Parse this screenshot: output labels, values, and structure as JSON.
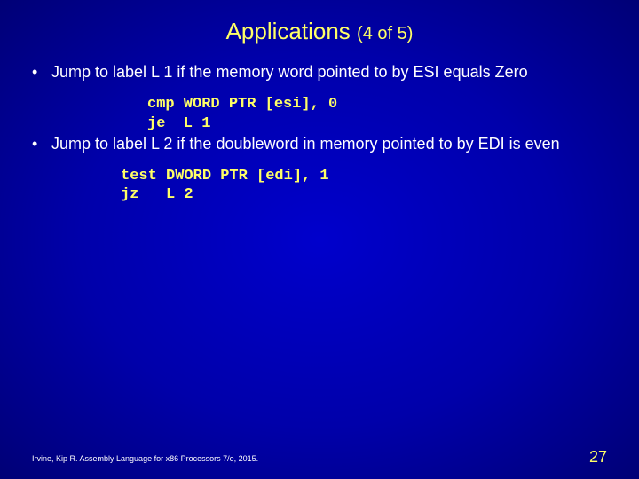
{
  "title": {
    "main": "Applications",
    "sub": "(4 of 5)"
  },
  "bullets": [
    {
      "text": "Jump to label L 1 if the memory word pointed to by ESI equals Zero",
      "code": "cmp WORD PTR [esi], 0\nje  L 1"
    },
    {
      "text": "Jump to label L 2 if the doubleword in memory pointed to by EDI is even",
      "code": "test DWORD PTR [edi], 1\njz   L 2"
    }
  ],
  "footer": "Irvine, Kip R. Assembly Language for x86 Processors 7/e, 2015.",
  "page_number": "27"
}
